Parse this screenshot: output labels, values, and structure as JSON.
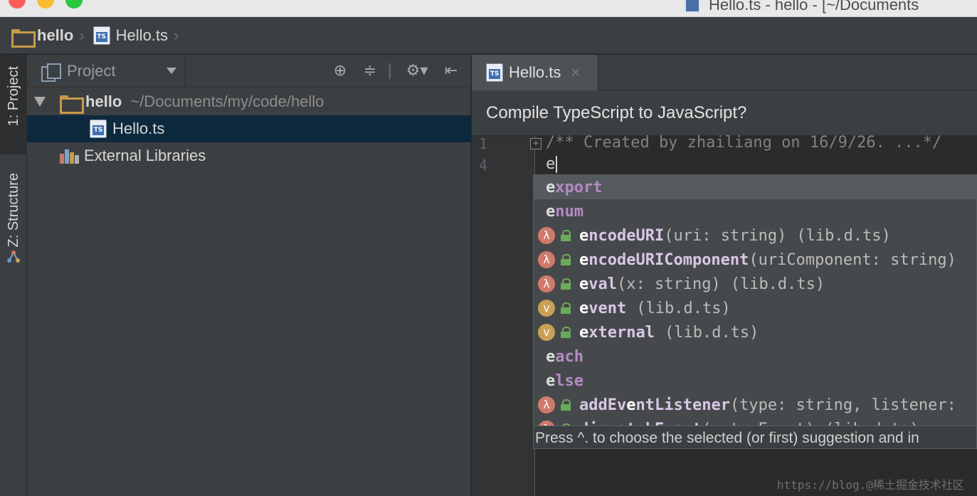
{
  "window": {
    "title": "Hello.ts - hello - [~/Documents"
  },
  "breadcrumb": {
    "project": "hello",
    "file": "Hello.ts"
  },
  "stripe": {
    "project_tab": "1: Project",
    "structure_tab": "Z: Structure"
  },
  "project_panel": {
    "title": "Project",
    "tree": {
      "root_name": "hello",
      "root_path": "~/Documents/my/code/hello",
      "file": "Hello.ts",
      "external": "External Libraries"
    }
  },
  "editor": {
    "tab_label": "Hello.ts",
    "tab_close": "×",
    "banner": "Compile TypeScript to JavaScript?",
    "lines": [
      {
        "number": "1",
        "text": "/** Created by zhailiang on 16/9/26. ...*/"
      },
      {
        "number": "4",
        "text": "e"
      }
    ]
  },
  "completion": {
    "items": [
      {
        "kind": "keyword",
        "name": "export"
      },
      {
        "kind": "keyword",
        "name": "enum"
      },
      {
        "kind": "function",
        "badge": "λ",
        "name": "encodeURI",
        "signature": "(uri: string)",
        "source": "(lib.d.ts)"
      },
      {
        "kind": "function",
        "badge": "λ",
        "name": "encodeURIComponent",
        "signature": "(uriComponent: string)",
        "source": ""
      },
      {
        "kind": "function",
        "badge": "λ",
        "name": "eval",
        "signature": "(x: string)",
        "source": "(lib.d.ts)"
      },
      {
        "kind": "variable",
        "badge": "v",
        "name": "event",
        "signature": "",
        "source": "(lib.d.ts)"
      },
      {
        "kind": "variable",
        "badge": "v",
        "name": "external",
        "signature": "",
        "source": "(lib.d.ts)"
      },
      {
        "kind": "keyword",
        "name": "each"
      },
      {
        "kind": "keyword",
        "name": "else"
      },
      {
        "kind": "function",
        "badge": "λ",
        "name": "addEventListener",
        "signature": "(type: string, listener:",
        "source": ""
      },
      {
        "kind": "function",
        "badge": "λ",
        "name": "dispatchEvent",
        "signature": "(evt: Event)",
        "source": "(lib.d.ts)"
      }
    ],
    "footer": "Press ^. to choose the selected (or first) suggestion and in"
  },
  "watermark": "https://blog.@稀土掘金技术社区",
  "colors": {
    "keyword": "#cc7832",
    "lambda_badge": "#d07a6c",
    "var_badge": "#c9a055",
    "selection": "#0d293e"
  },
  "icons": {
    "folder": "folder-icon",
    "typescript_file": "typescript-file-icon",
    "gear": "gear-icon",
    "locate": "locate-icon"
  }
}
